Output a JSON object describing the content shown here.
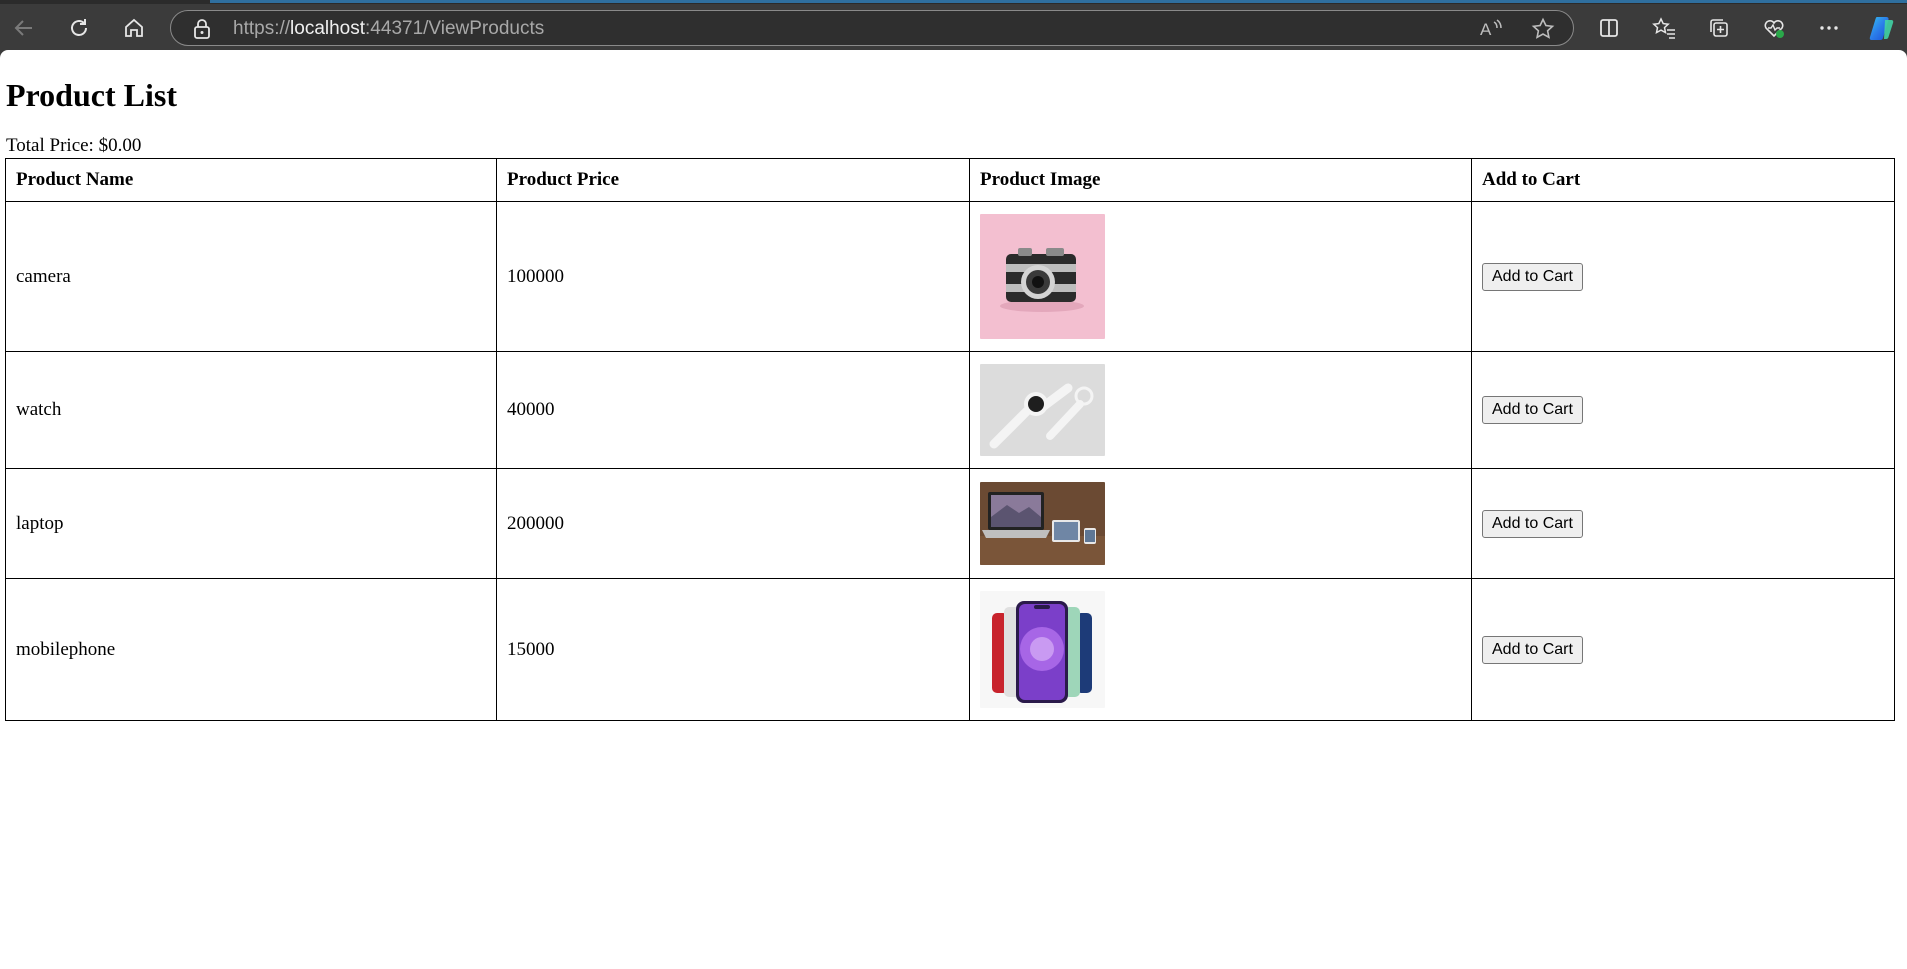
{
  "browser": {
    "url_scheme": "https://",
    "url_host": "localhost",
    "url_rest": ":44371/ViewProducts"
  },
  "page": {
    "title": "Product List",
    "total_label": "Total Price: $0.00"
  },
  "table": {
    "headers": [
      "Product Name",
      "Product Price",
      "Product Image",
      "Add to Cart"
    ],
    "rows": [
      {
        "name": "camera",
        "price": "100000",
        "image": "camera-photo",
        "button": "Add to Cart"
      },
      {
        "name": "watch",
        "price": "40000",
        "image": "watch-photo",
        "button": "Add to Cart"
      },
      {
        "name": "laptop",
        "price": "200000",
        "image": "laptop-photo",
        "button": "Add to Cart"
      },
      {
        "name": "mobilephone",
        "price": "15000",
        "image": "mobilephone-photo",
        "button": "Add to Cart"
      }
    ]
  },
  "colors": {
    "chrome_bg": "#3b3b3b",
    "accent": "#2f6f9f",
    "page_bg": "#ffffff"
  }
}
